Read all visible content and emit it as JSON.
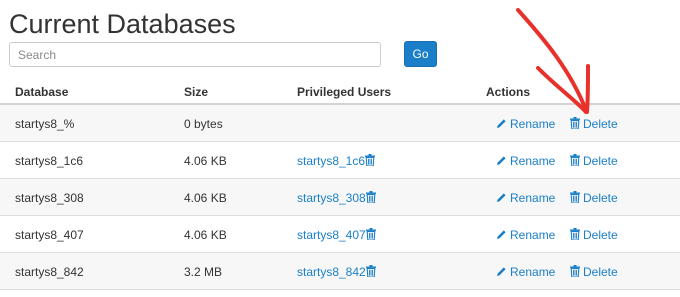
{
  "page": {
    "title": "Current Databases"
  },
  "search": {
    "placeholder": "Search",
    "go_label": "Go"
  },
  "table": {
    "headers": {
      "database": "Database",
      "size": "Size",
      "users": "Privileged Users",
      "actions": "Actions"
    },
    "rename_label": "Rename",
    "delete_label": "Delete",
    "rows": [
      {
        "database": "startys8_%",
        "size": "0 bytes",
        "user": ""
      },
      {
        "database": "startys8_1c6",
        "size": "4.06 KB",
        "user": "startys8_1c6"
      },
      {
        "database": "startys8_308",
        "size": "4.06 KB",
        "user": "startys8_308"
      },
      {
        "database": "startys8_407",
        "size": "4.06 KB",
        "user": "startys8_407"
      },
      {
        "database": "startys8_842",
        "size": "3.2 MB",
        "user": "startys8_842"
      }
    ]
  },
  "colors": {
    "link": "#1a7fc8",
    "go_button": "#1a7fc8",
    "annotation_arrow": "#e8312a"
  },
  "icons": {
    "rename": "pencil-icon",
    "delete": "trash-icon",
    "revoke_user": "trash-icon",
    "annotation": "red-arrow-annotation"
  }
}
